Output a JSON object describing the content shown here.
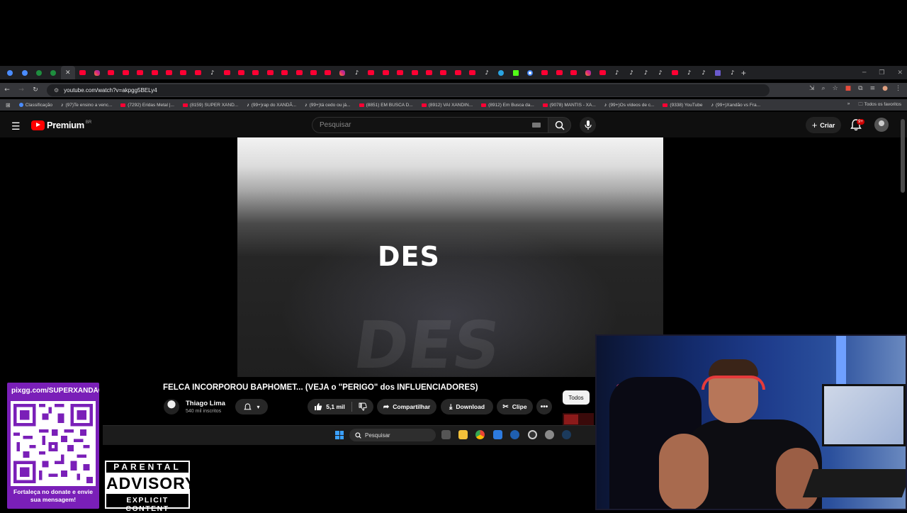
{
  "browser": {
    "url": "youtube.com/watch?v=akpgg5BELy4",
    "tabs_favicons": [
      "chrome",
      "chrome",
      "green",
      "green",
      "close",
      "yt",
      "ig",
      "yt",
      "yt",
      "yt",
      "yt",
      "yt",
      "yt",
      "yt",
      "tt",
      "yt",
      "yt",
      "yt",
      "yt",
      "yt",
      "yt",
      "yt",
      "yt",
      "ig",
      "tt",
      "yt",
      "yt",
      "yt",
      "yt",
      "yt",
      "yt",
      "yt",
      "yt",
      "tt",
      "tg",
      "kk",
      "gg",
      "yt",
      "yt",
      "yt",
      "ig",
      "yt",
      "tt",
      "tt",
      "tt",
      "tt",
      "yt",
      "tt",
      "tt",
      "ms",
      "tt"
    ],
    "bookmarks": [
      {
        "label": "Classificação",
        "icon": "g"
      },
      {
        "label": "(97)Te ensino a venc...",
        "icon": "t"
      },
      {
        "label": "(7292) Eridas Metal |...",
        "icon": "y"
      },
      {
        "label": "(8159) SUPER XAND...",
        "icon": "y"
      },
      {
        "label": "(99+)rap do XANDÃ...",
        "icon": "t"
      },
      {
        "label": "(99+)tá cedo ou já...",
        "icon": "t"
      },
      {
        "label": "(8851) EM BUSCA D...",
        "icon": "y"
      },
      {
        "label": "(8912) VAI XANDIN...",
        "icon": "y"
      },
      {
        "label": "(8912) Em Busca da...",
        "icon": "y"
      },
      {
        "label": "(9078) MANTIS - XA...",
        "icon": "y"
      },
      {
        "label": "(99+)Os vídeos de c...",
        "icon": "t"
      },
      {
        "label": "(9338) YouTube",
        "icon": "y"
      },
      {
        "label": "(99+)Xandão vs Fra...",
        "icon": "t"
      }
    ],
    "all_bookmarks_label": "Todos os favoritos",
    "accent_color": "#ff0033"
  },
  "youtube": {
    "logo_text": "Premium",
    "country_code": "BR",
    "search_placeholder": "Pesquisar",
    "create_label": "Criar",
    "notification_badge": "9+",
    "video_overlay_text": "DES",
    "video_overlay_text_2": "DES",
    "title": "FELCA INCORPOROU BAPHOMET... (VEJA o \"PERIGO\" dos INFLUENCIADORES)",
    "channel_name": "Thiago Lima",
    "subscribers": "540 mil inscritos",
    "likes": "5,1 mil",
    "share_label": "Compartilhar",
    "download_label": "Download",
    "clip_label": "Clipe",
    "filter_chip": "Todos"
  },
  "taskbar": {
    "search_placeholder": "Pesquisar"
  },
  "overlay": {
    "qr_url": "pixgg.com/SUPERXANDÃO",
    "qr_caption": "Fortaleça no donate e envie sua mensagem!",
    "parental_top": "PARENTAL",
    "parental_mid": "ADVISORY",
    "parental_bottom": "EXPLICIT CONTENT",
    "panel_color": "#7a1fb8"
  }
}
